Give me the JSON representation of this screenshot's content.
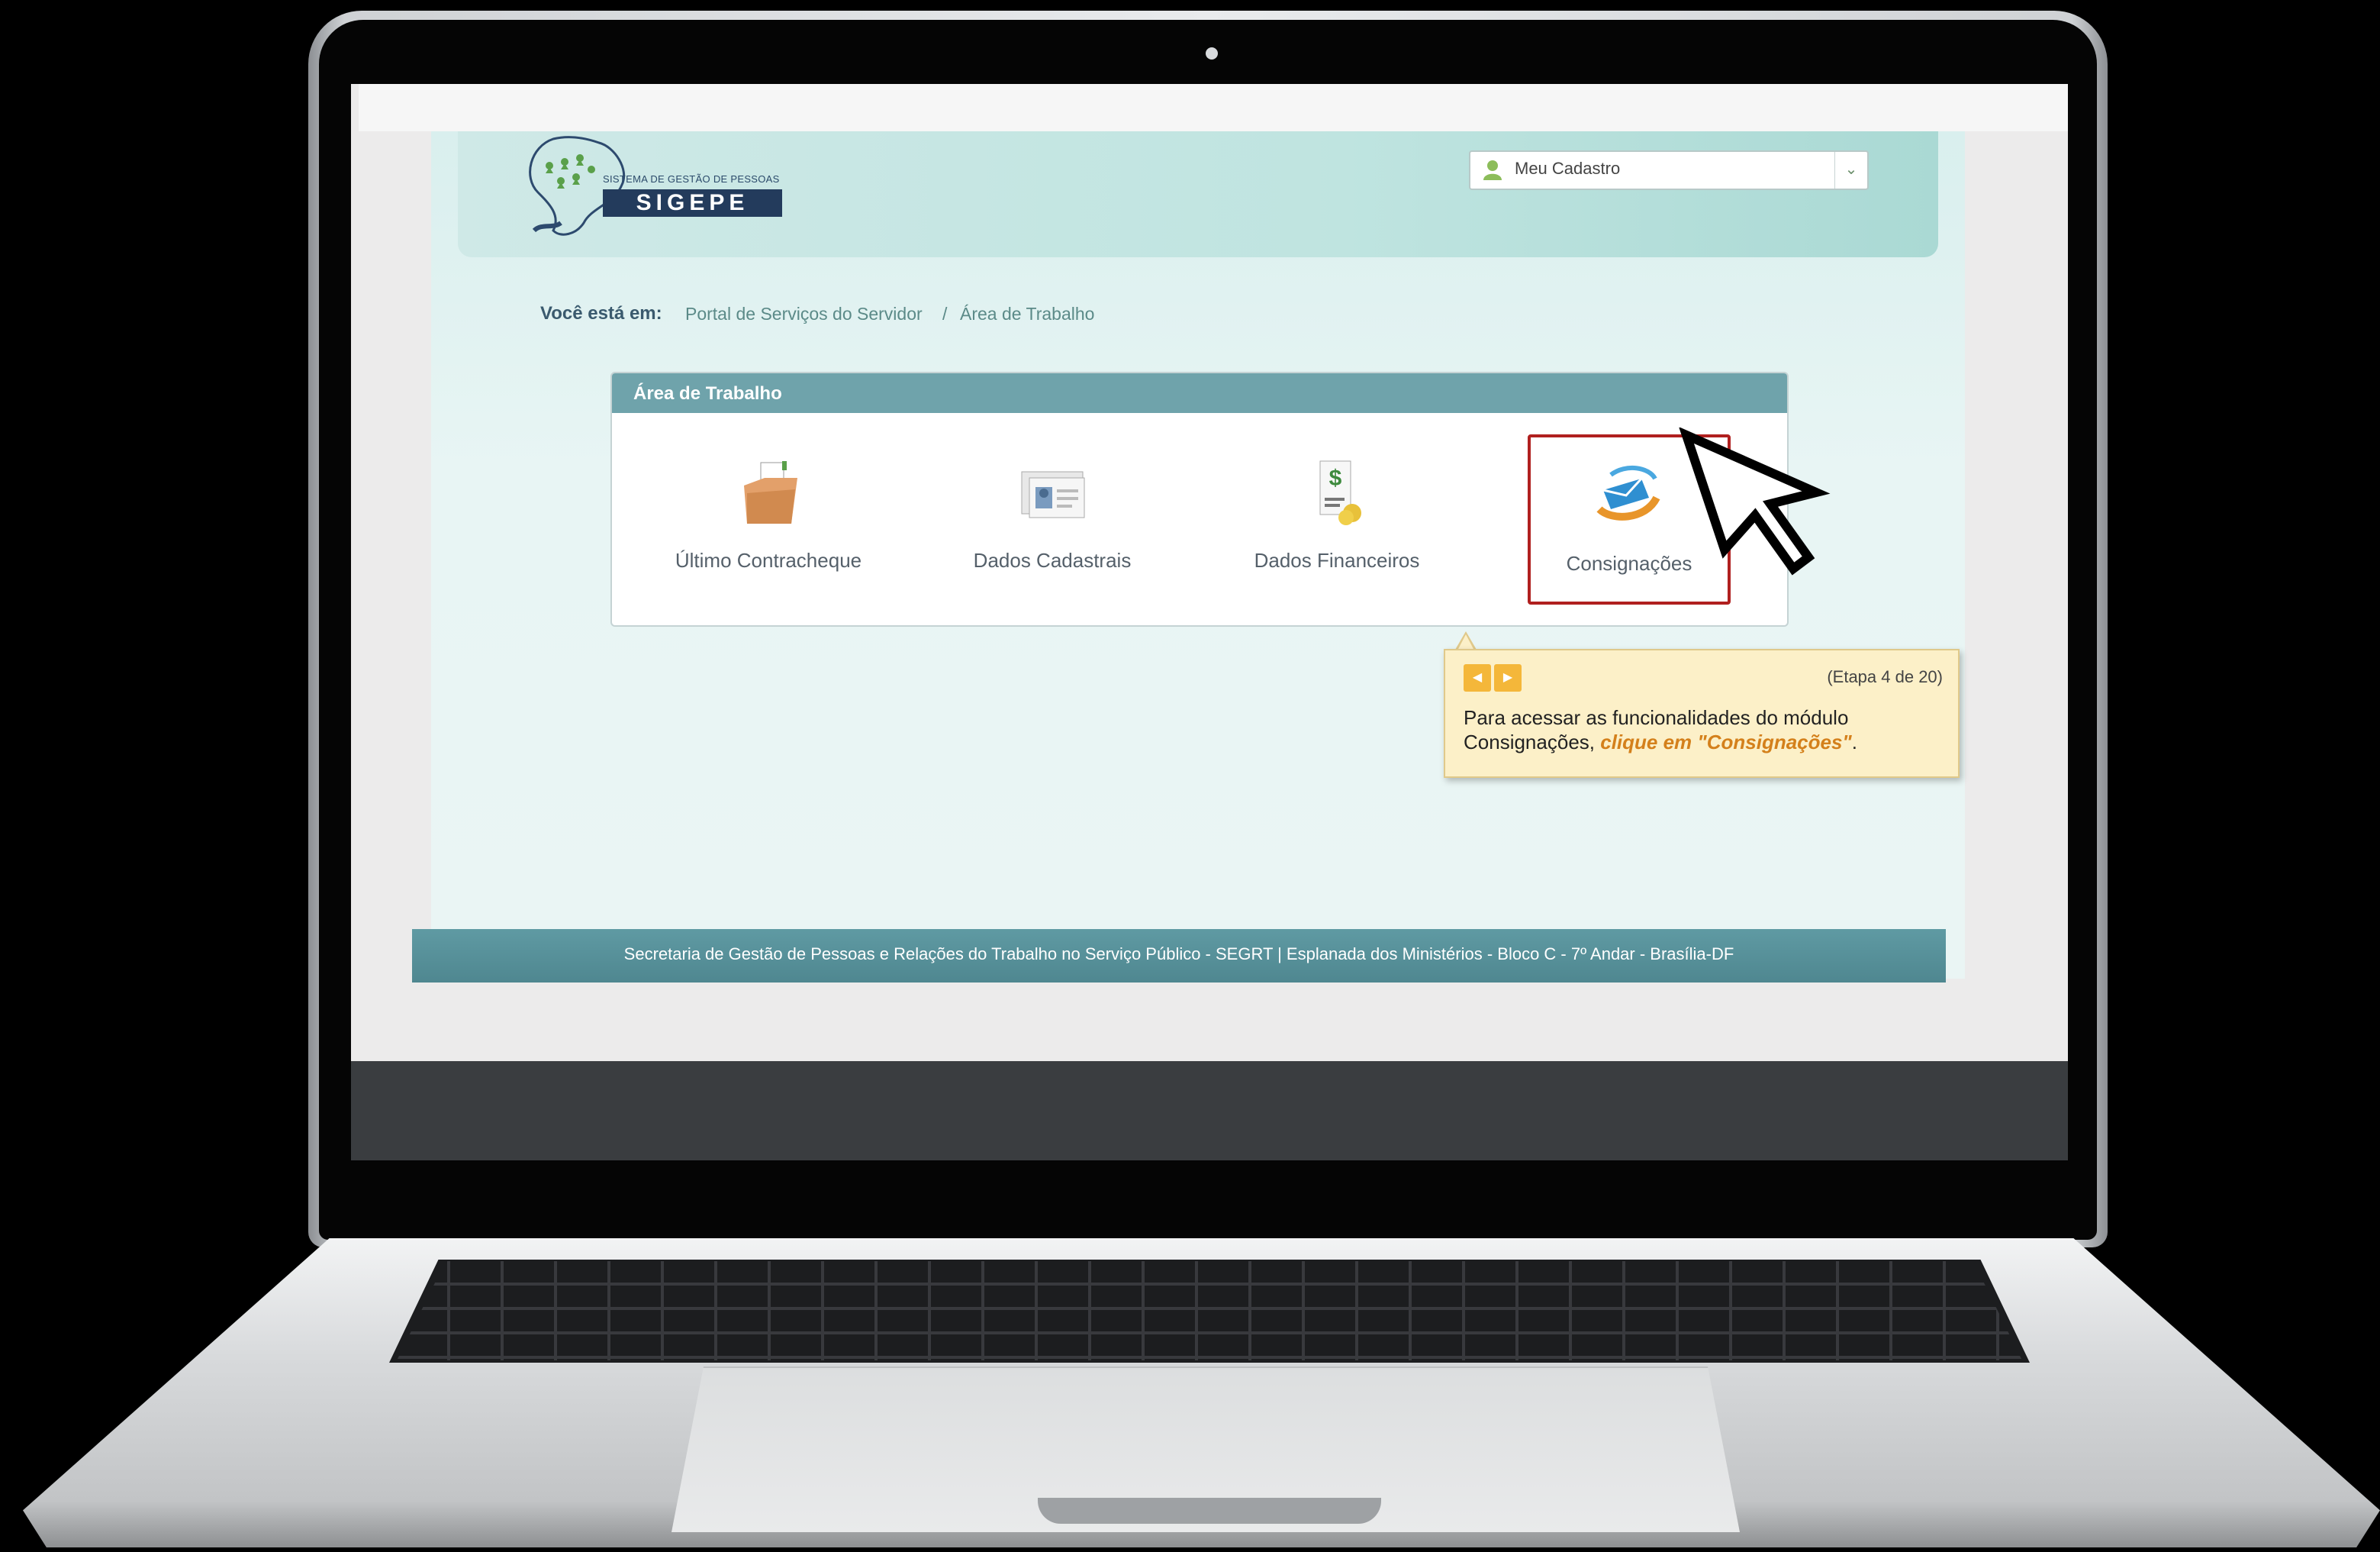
{
  "logo": {
    "small_text": "SISTEMA DE GESTÃO DE PESSOAS",
    "name": "SIGEPE"
  },
  "header": {
    "dropdown_label": "Meu Cadastro"
  },
  "breadcrumb": {
    "lead": "Você está em:",
    "items": [
      "Portal de Serviços do Servidor",
      "Área de Trabalho"
    ],
    "separator": "/"
  },
  "panel": {
    "title": "Área de Trabalho",
    "tiles": [
      {
        "label": "Último Contracheque",
        "icon": "folder-icon"
      },
      {
        "label": "Dados Cadastrais",
        "icon": "id-cards-icon"
      },
      {
        "label": "Dados Financeiros",
        "icon": "money-document-icon"
      },
      {
        "label": "Consignações",
        "icon": "envelope-swirl-icon",
        "highlighted": true
      }
    ]
  },
  "tooltip": {
    "step": "(Etapa 4 de 20)",
    "text_before": "Para acessar as funcionalidades do módulo Consignações, ",
    "text_emphasis": "clique em \"Consignações\"",
    "text_after": "."
  },
  "footer": {
    "text": "Secretaria de Gestão de Pessoas e Relações do Trabalho no Serviço Público - SEGRT | Esplanada dos Ministérios - Bloco C - 7º Andar - Brasília-DF"
  },
  "colors": {
    "highlight": "#b0201f",
    "panel_header": "#6fa3ab",
    "footer": "#5f9aa3",
    "tooltip_bg": "#fcf0c8",
    "emphasis": "#d4801b"
  }
}
